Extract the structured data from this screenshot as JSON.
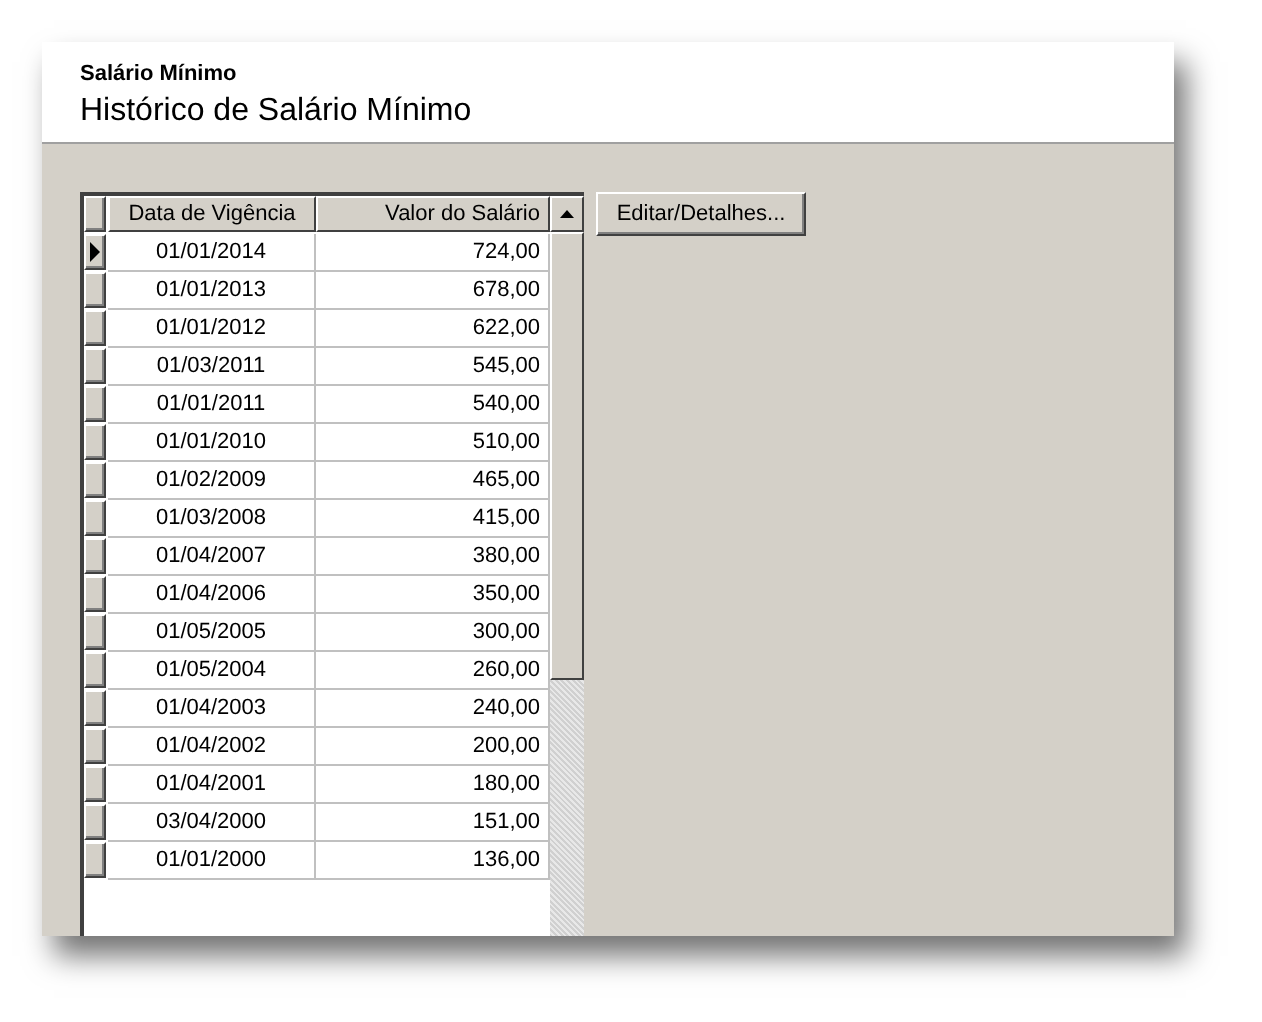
{
  "header": {
    "subtitle": "Salário Mínimo",
    "title": "Histórico de Salário Mínimo"
  },
  "table": {
    "columns": [
      "Data de Vigência",
      "Valor do Salário"
    ],
    "rows": [
      {
        "date": "01/01/2014",
        "value": "724,00",
        "selected": true
      },
      {
        "date": "01/01/2013",
        "value": "678,00",
        "selected": false
      },
      {
        "date": "01/01/2012",
        "value": "622,00",
        "selected": false
      },
      {
        "date": "01/03/2011",
        "value": "545,00",
        "selected": false
      },
      {
        "date": "01/01/2011",
        "value": "540,00",
        "selected": false
      },
      {
        "date": "01/01/2010",
        "value": "510,00",
        "selected": false
      },
      {
        "date": "01/02/2009",
        "value": "465,00",
        "selected": false
      },
      {
        "date": "01/03/2008",
        "value": "415,00",
        "selected": false
      },
      {
        "date": "01/04/2007",
        "value": "380,00",
        "selected": false
      },
      {
        "date": "01/04/2006",
        "value": "350,00",
        "selected": false
      },
      {
        "date": "01/05/2005",
        "value": "300,00",
        "selected": false
      },
      {
        "date": "01/05/2004",
        "value": "260,00",
        "selected": false
      },
      {
        "date": "01/04/2003",
        "value": "240,00",
        "selected": false
      },
      {
        "date": "01/04/2002",
        "value": "200,00",
        "selected": false
      },
      {
        "date": "01/04/2001",
        "value": "180,00",
        "selected": false
      },
      {
        "date": "03/04/2000",
        "value": "151,00",
        "selected": false
      },
      {
        "date": "01/01/2000",
        "value": "136,00",
        "selected": false
      }
    ]
  },
  "buttons": [
    "Editar/Detalhes..."
  ]
}
